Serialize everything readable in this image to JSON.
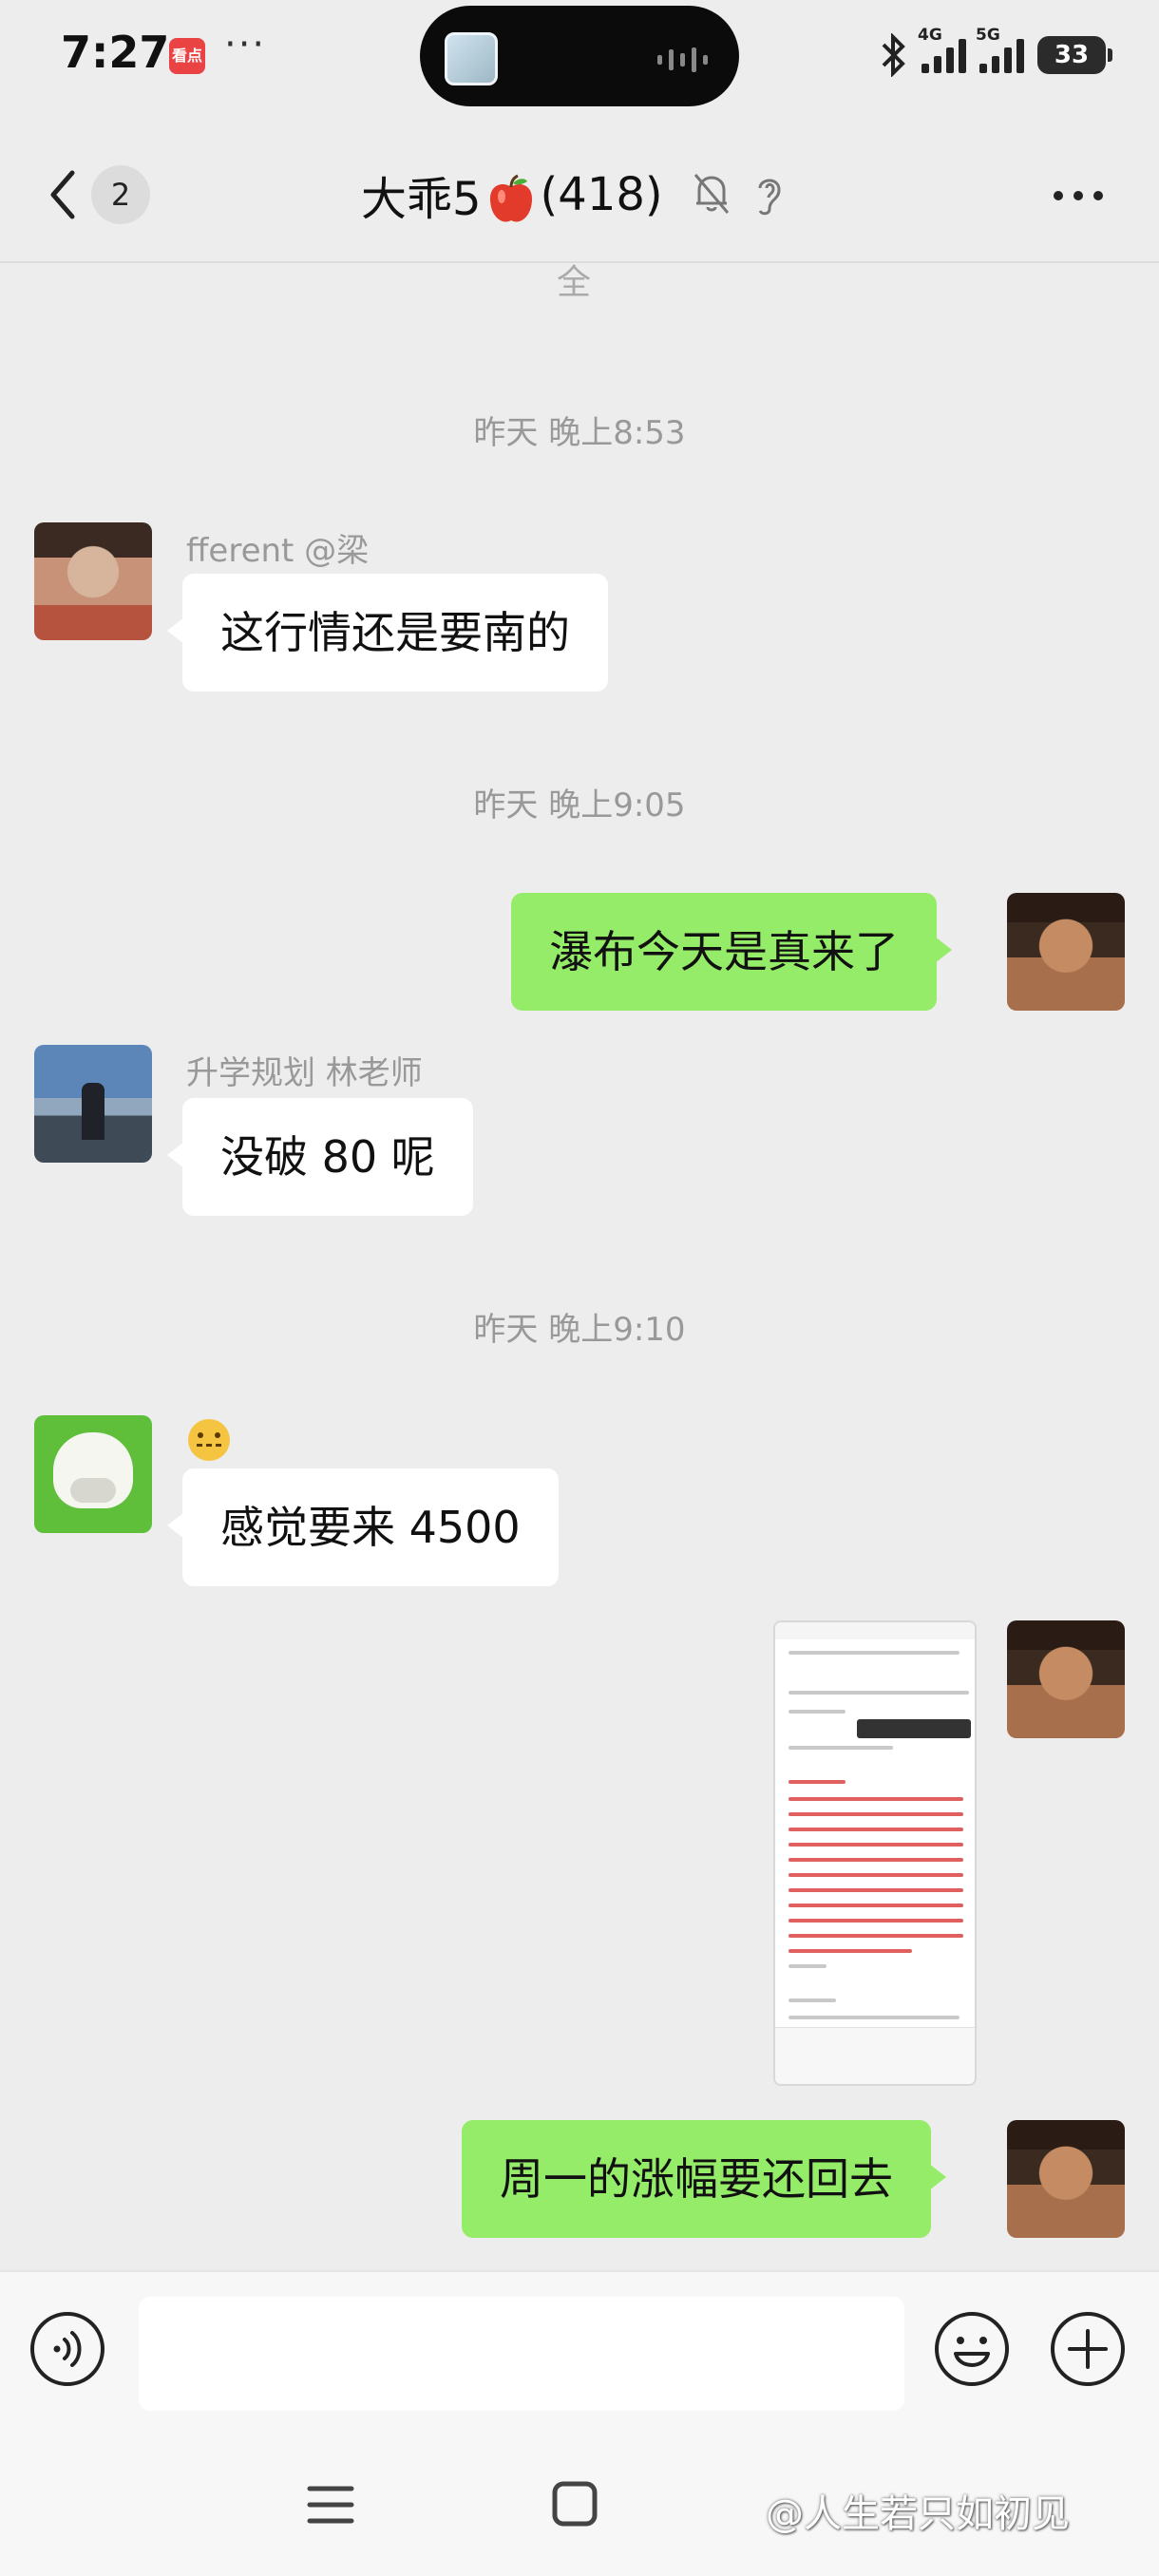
{
  "status_bar": {
    "time": "7:27",
    "app_badge": "看点",
    "dots": "···",
    "network_1": "4G",
    "network_2": "5G",
    "battery": "33"
  },
  "header": {
    "unread_count": "2",
    "title_prefix": "大乖5",
    "title_suffix": "(418)",
    "partial_char": "全"
  },
  "messages": [
    {
      "type": "time",
      "text": "昨天 晚上8:53"
    },
    {
      "type": "incoming",
      "sender": "fferent  @梁",
      "text": "这行情还是要南的",
      "avatar": "man-avatar"
    },
    {
      "type": "time",
      "text": "昨天 晚上9:05"
    },
    {
      "type": "outgoing",
      "text": "瀑布今天是真来了",
      "avatar": "self-avatar"
    },
    {
      "type": "incoming",
      "sender": "升学规划  林老师",
      "text": "没破 80 呢",
      "avatar": "sky-avatar"
    },
    {
      "type": "time",
      "text": "昨天 晚上9:10"
    },
    {
      "type": "incoming",
      "sender_emoji": "zipper-mouth-emoji",
      "text": "感觉要来 4500",
      "avatar": "cow-avatar"
    },
    {
      "type": "outgoing-image",
      "avatar": "self-avatar"
    },
    {
      "type": "outgoing",
      "text": "周一的涨幅要还回去",
      "avatar": "self-avatar"
    }
  ],
  "input": {
    "placeholder": ""
  },
  "watermark": "@人生若只如初见",
  "colors": {
    "background": "#ededed",
    "outgoing_bubble": "#95ec69",
    "incoming_bubble": "#ffffff",
    "timestamp": "#999999"
  }
}
